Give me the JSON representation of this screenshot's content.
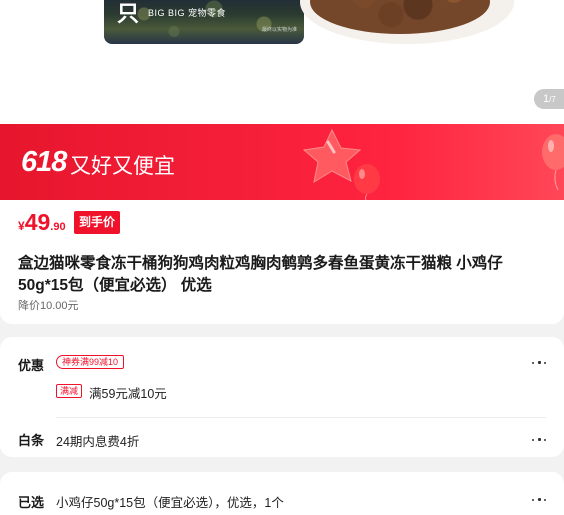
{
  "gallery": {
    "package_glyph": "只",
    "package_brand": "BIG BIG 宠物零食",
    "package_note": "最终以实物为准",
    "counter_current": "1",
    "counter_total": "7"
  },
  "banner": {
    "number": "618",
    "slogan": "又好又便宜",
    "colors": {
      "background": "#e6162d",
      "balloon": "#ff6b6b"
    }
  },
  "price": {
    "currency": "¥",
    "integer": "49",
    "decimal": ".90",
    "tag": "到手价"
  },
  "product": {
    "title": "盒边猫咪零食冻干桶狗狗鸡肉粒鸡胸肉鹌鹑多春鱼蛋黄冻干猫粮 小鸡仔50g*15包（便宜必选） 优选",
    "price_drop": "降价10.00元"
  },
  "discount": {
    "label": "优惠",
    "coupon_tag": "神券满99减10",
    "sub_tag": "满减",
    "sub_text": "满59元减10元"
  },
  "baitiao": {
    "label": "白条",
    "text": "24期内息费4折"
  },
  "selected": {
    "label": "已选",
    "text": "小鸡仔50g*15包（便宜必选），优选，1个"
  },
  "icons": {
    "more": "more-dots-icon",
    "star": "star-balloon-icon",
    "balloon": "balloon-icon"
  },
  "accent_color": "#f0122a"
}
